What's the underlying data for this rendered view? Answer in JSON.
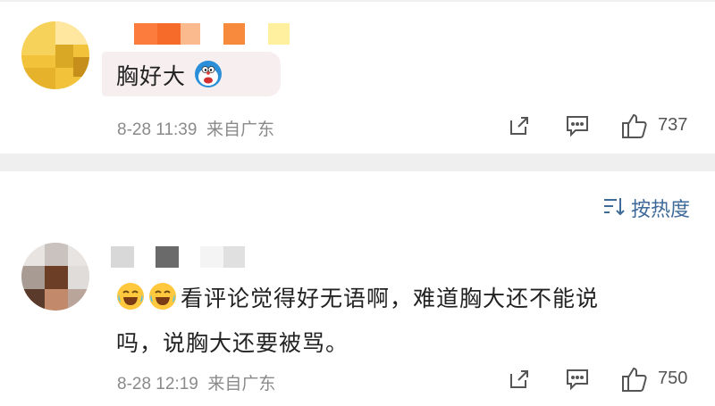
{
  "comments": [
    {
      "text": "胸好大",
      "emoji_after": "doraemon-emoji",
      "timestamp": "8-28 11:39",
      "location": "来自广东",
      "likes": "737"
    },
    {
      "emoji_before": [
        "laugh-cry-emoji",
        "laugh-cry-emoji"
      ],
      "text_line1": "看评论觉得好无语啊，难道胸大还不能说",
      "text_line2": "吗，说胸大还要被骂。",
      "timestamp": "8-28 12:19",
      "location": "来自广东",
      "likes": "750"
    }
  ],
  "sort": {
    "label": "按热度",
    "icon": "sort-icon"
  },
  "colors": {
    "link_blue": "#3e6a9a",
    "meta_gray": "#8a8a8a",
    "bubble_pink": "#f7eef0",
    "divider": "#efefef"
  }
}
